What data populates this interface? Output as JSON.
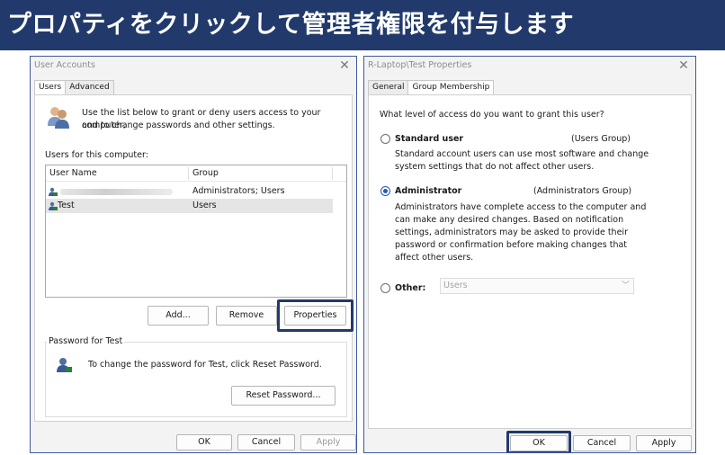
{
  "banner": {
    "text": "プロパティをクリックして管理者権限を付与します"
  },
  "user_accounts": {
    "title": "User Accounts",
    "tabs": [
      "Users",
      "Advanced"
    ],
    "intro": [
      "Use the list below to grant or deny users access to your computer,",
      "and to change passwords and other settings."
    ],
    "users_label": "Users for this computer:",
    "columns": [
      "User Name",
      "Group"
    ],
    "rows": [
      {
        "name": "",
        "group": "Administrators; Users"
      },
      {
        "name": "Test",
        "group": "Users"
      }
    ],
    "buttons": {
      "add": "Add...",
      "remove": "Remove",
      "properties": "Properties"
    },
    "password_group": "Password for Test",
    "password_text": "To change the password for Test, click Reset Password.",
    "reset_button": "Reset Password...",
    "footer": {
      "ok": "OK",
      "cancel": "Cancel",
      "apply": "Apply"
    }
  },
  "properties": {
    "title": "R-Laptop\\Test Properties",
    "tabs": [
      "General",
      "Group Membership"
    ],
    "question": "What level of access do you want to grant this user?",
    "standard": {
      "label": "Standard user",
      "group": "(Users Group)",
      "desc": [
        "Standard account users can use most software and change",
        "system settings that do not affect other users."
      ]
    },
    "administrator": {
      "label": "Administrator",
      "group": "(Administrators Group)",
      "desc": [
        "Administrators have complete access to the computer and",
        "can make any desired changes. Based on notification",
        "settings, administrators may be asked to provide their",
        "password or confirmation before making changes that",
        "affect other users."
      ]
    },
    "other": {
      "label": "Other:",
      "value": "Users"
    },
    "footer": {
      "ok": "OK",
      "cancel": "Cancel",
      "apply": "Apply"
    }
  },
  "colors": {
    "banner": "#213a6b",
    "highlight": "#213a6b",
    "radio_selected": "#1f5bb8"
  }
}
